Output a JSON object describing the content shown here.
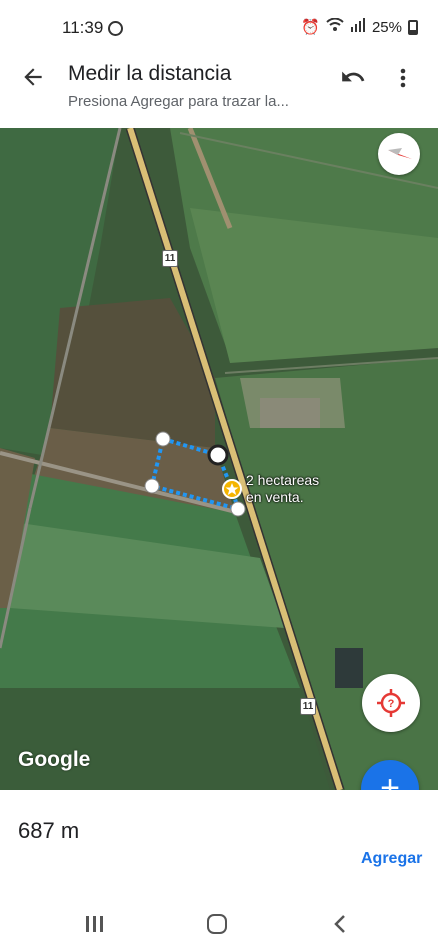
{
  "status_bar": {
    "time": "11:39",
    "battery": "25%",
    "icons": [
      "whatsapp-icon",
      "alarm-icon",
      "wifi-icon",
      "signal-icon",
      "battery-icon"
    ]
  },
  "app_bar": {
    "title": "Medir la distancia",
    "subtitle": "Presiona Agregar para trazar la...",
    "back_icon": "arrow-back-icon",
    "undo_icon": "undo-icon",
    "more_icon": "more-vert-icon"
  },
  "map": {
    "place_label_line1": "2 hectareas",
    "place_label_line2": "en venta.",
    "route_number": "11",
    "attribution": "Google",
    "measure_line_color": "#2196f3",
    "road_color": "#d9bf76"
  },
  "bottom_panel": {
    "distance": "687 m",
    "add_label": "Agregar"
  },
  "fab": {
    "icon": "plus-icon",
    "symbol": "+"
  },
  "nav_bar": {
    "icons": [
      "recents-icon",
      "home-icon",
      "back-icon"
    ]
  }
}
